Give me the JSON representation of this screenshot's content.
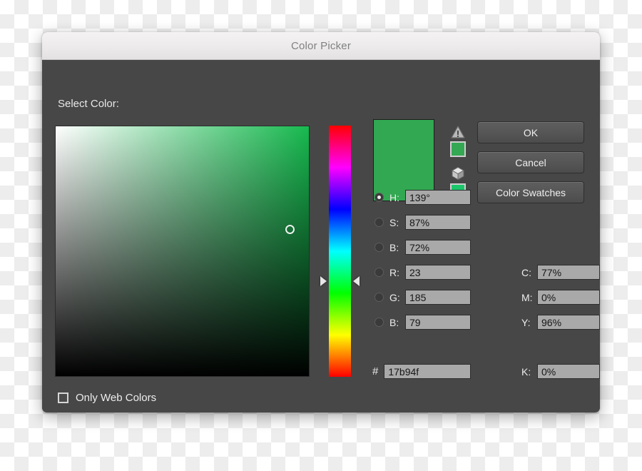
{
  "window": {
    "title": "Color Picker"
  },
  "dialog": {
    "select_color_label": "Select Color:",
    "current_color_hex": "#32a852",
    "gradient_base_hex": "#17b94f",
    "icons": {
      "gamut_warning": "gamut-warning-icon",
      "websafe_cube": "websafe-cube-icon"
    },
    "swatches": {
      "in_gamut_hex": "#34a853",
      "websafe_hex": "#1bc76a"
    },
    "buttons": {
      "ok": "OK",
      "cancel": "Cancel",
      "color_swatches": "Color Swatches"
    },
    "fields": [
      {
        "name": "hue",
        "label": "H:",
        "value": "139°",
        "selected": true
      },
      {
        "name": "saturation",
        "label": "S:",
        "value": "87%",
        "selected": false
      },
      {
        "name": "brightness",
        "label": "B:",
        "value": "72%",
        "selected": false
      },
      {
        "name": "red",
        "label": "R:",
        "value": "23",
        "selected": false
      },
      {
        "name": "green",
        "label": "G:",
        "value": "185",
        "selected": false
      },
      {
        "name": "blue",
        "label": "B:",
        "value": "79",
        "selected": false
      }
    ],
    "cmyk": [
      {
        "name": "cyan",
        "label": "C:",
        "value": "77%"
      },
      {
        "name": "magenta",
        "label": "M:",
        "value": "0%"
      },
      {
        "name": "yellow",
        "label": "Y:",
        "value": "96%"
      },
      {
        "name": "key",
        "label": "K:",
        "value": "0%"
      }
    ],
    "hex": {
      "sign": "#",
      "value": "17b94f"
    },
    "only_web_colors": {
      "label": "Only Web Colors",
      "checked": false
    }
  }
}
